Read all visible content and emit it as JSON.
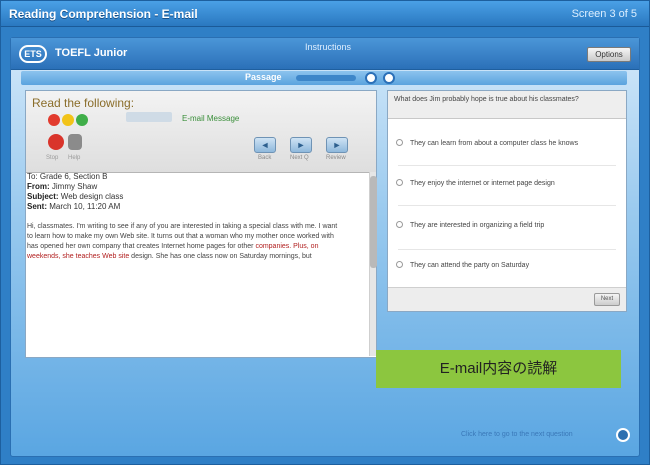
{
  "window": {
    "title": "Reading Comprehension - E-mail",
    "screen": "Screen 3 of 5"
  },
  "header": {
    "logo": "ETS",
    "user": "TOEFL Junior",
    "center_label": "Instructions",
    "button": "Options"
  },
  "passage_nav": {
    "label": "Passage"
  },
  "left": {
    "heading": "Read the following:",
    "audio_label": "E-mail Message",
    "icon_labels": [
      "Stop",
      "Help"
    ],
    "controls": [
      {
        "symbol": "◄",
        "label": "Back"
      },
      {
        "symbol": "►",
        "label": "Next Q"
      },
      {
        "symbol": "►",
        "label": "Review"
      }
    ],
    "email": {
      "to": "To: Grade 6, Section B",
      "from_label": "From:",
      "from_value": "Jimmy Shaw",
      "subject_label": "Subject:",
      "subject_value": "Web design class",
      "sent_label": "Sent:",
      "sent_value": "March 10, 11:20 AM",
      "body_normal": "Hi, classmates. I'm writing to see if any of you are interested in taking a special class with me. I want to learn how to make my own Web site. It turns out that a woman who my mother once worked with has opened her own company that creates Internet home pages for other",
      "body_red": "companies. Plus, on weekends, she teaches Web site",
      "body_end": "design. She has one class now on Saturday mornings, but"
    }
  },
  "question": {
    "prompt": "What does Jim probably hope is true about his classmates?",
    "options": [
      "They can learn from about a computer class he knows",
      "They enjoy the internet or internet page design",
      "They are interested in organizing a field trip",
      "They can attend the party on Saturday"
    ],
    "next": "Next"
  },
  "banner": "E-mail内容の読解",
  "footer": {
    "link": "Click here to go to the next question"
  }
}
